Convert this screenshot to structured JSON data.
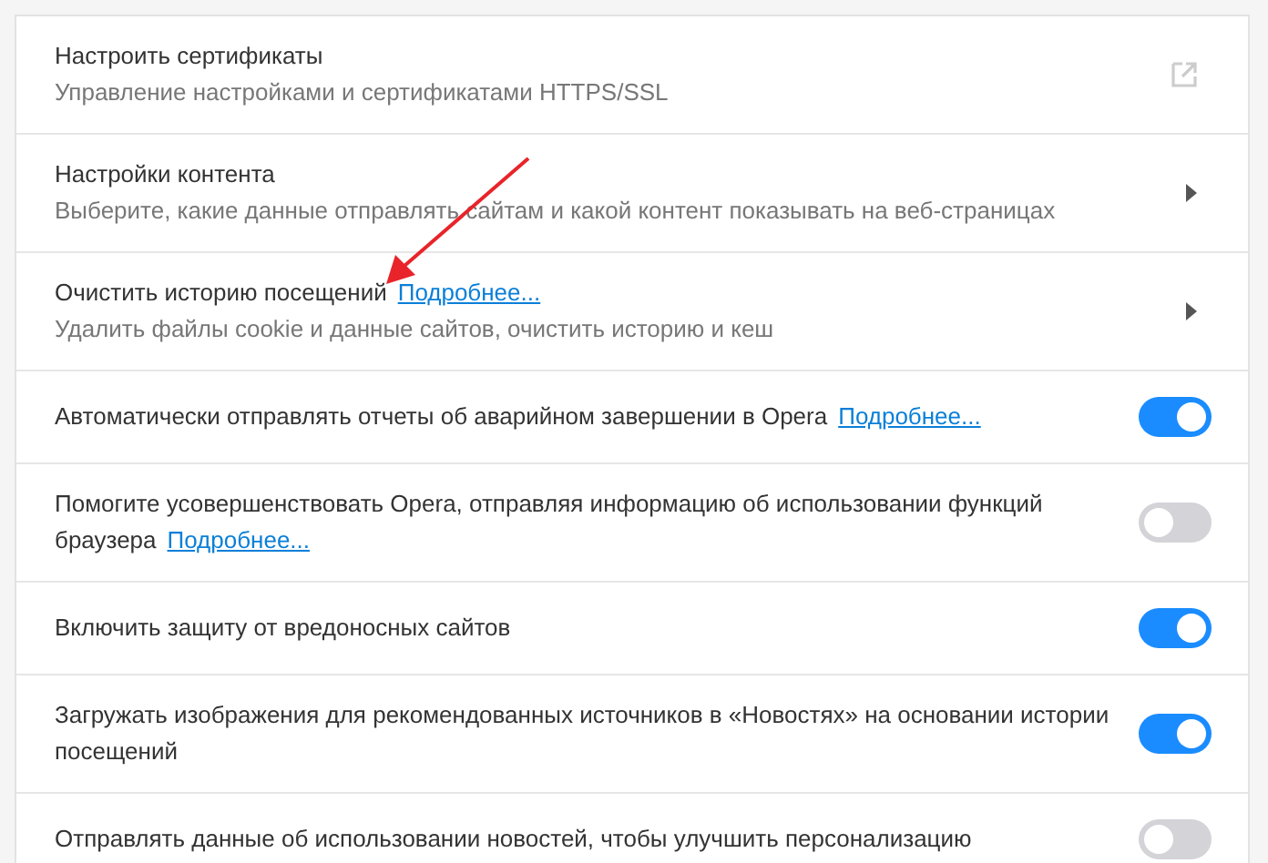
{
  "settings": [
    {
      "kind": "external",
      "title": "Настроить сертификаты",
      "subtitle": "Управление настройками и сертификатами HTTPS/SSL"
    },
    {
      "kind": "nav",
      "title": "Настройки контента",
      "subtitle": "Выберите, какие данные отправлять сайтам и какой контент показывать на веб-страницах"
    },
    {
      "kind": "nav",
      "title": "Очистить историю посещений",
      "link": "Подробнее...",
      "subtitle": "Удалить файлы cookie и данные сайтов, очистить историю и кеш"
    },
    {
      "kind": "toggle",
      "title": "Автоматически отправлять отчеты об аварийном завершении в Opera",
      "link": "Подробнее...",
      "on": true
    },
    {
      "kind": "toggle",
      "title": "Помогите усовершенствовать Opera, отправляя информацию об использовании функций браузера",
      "link": "Подробнее...",
      "on": false
    },
    {
      "kind": "toggle",
      "title": "Включить защиту от вредоносных сайтов",
      "on": true
    },
    {
      "kind": "toggle",
      "title": "Загружать изображения для рекомендованных источников в «Новостях» на основании истории посещений",
      "on": true
    },
    {
      "kind": "toggle",
      "title": "Отправлять данные об использовании новостей, чтобы улучшить персонализацию",
      "on": false
    }
  ]
}
